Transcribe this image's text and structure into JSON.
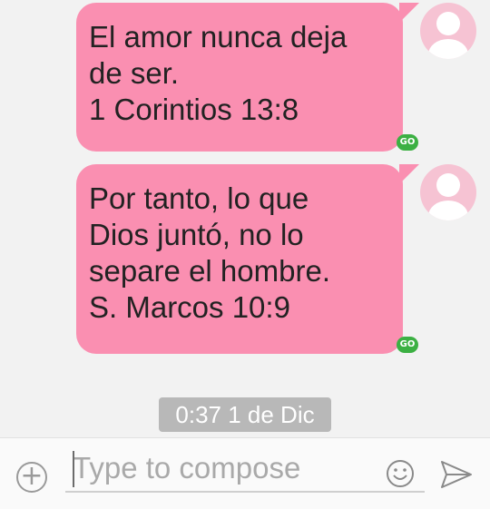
{
  "conversation": {
    "messages": [
      {
        "text": "El amor nunca deja\nde ser.\n1 Corintios 13:8",
        "badge": "GO"
      },
      {
        "text": "Por tanto, lo que\nDios juntó, no lo\nsepare el hombre.\nS. Marcos 10:9",
        "badge": "GO"
      }
    ],
    "timestamp": "0:37 1 de Dic"
  },
  "composer": {
    "placeholder": "Type to compose",
    "add_icon": "plus-circle-icon",
    "emoji_icon": "smiley-icon",
    "send_icon": "send-icon"
  },
  "colors": {
    "bubble": "#fa8fb1",
    "avatar": "#f6c3d3",
    "badge": "#3cb043",
    "timestamp_bg": "#b8b8b8"
  }
}
